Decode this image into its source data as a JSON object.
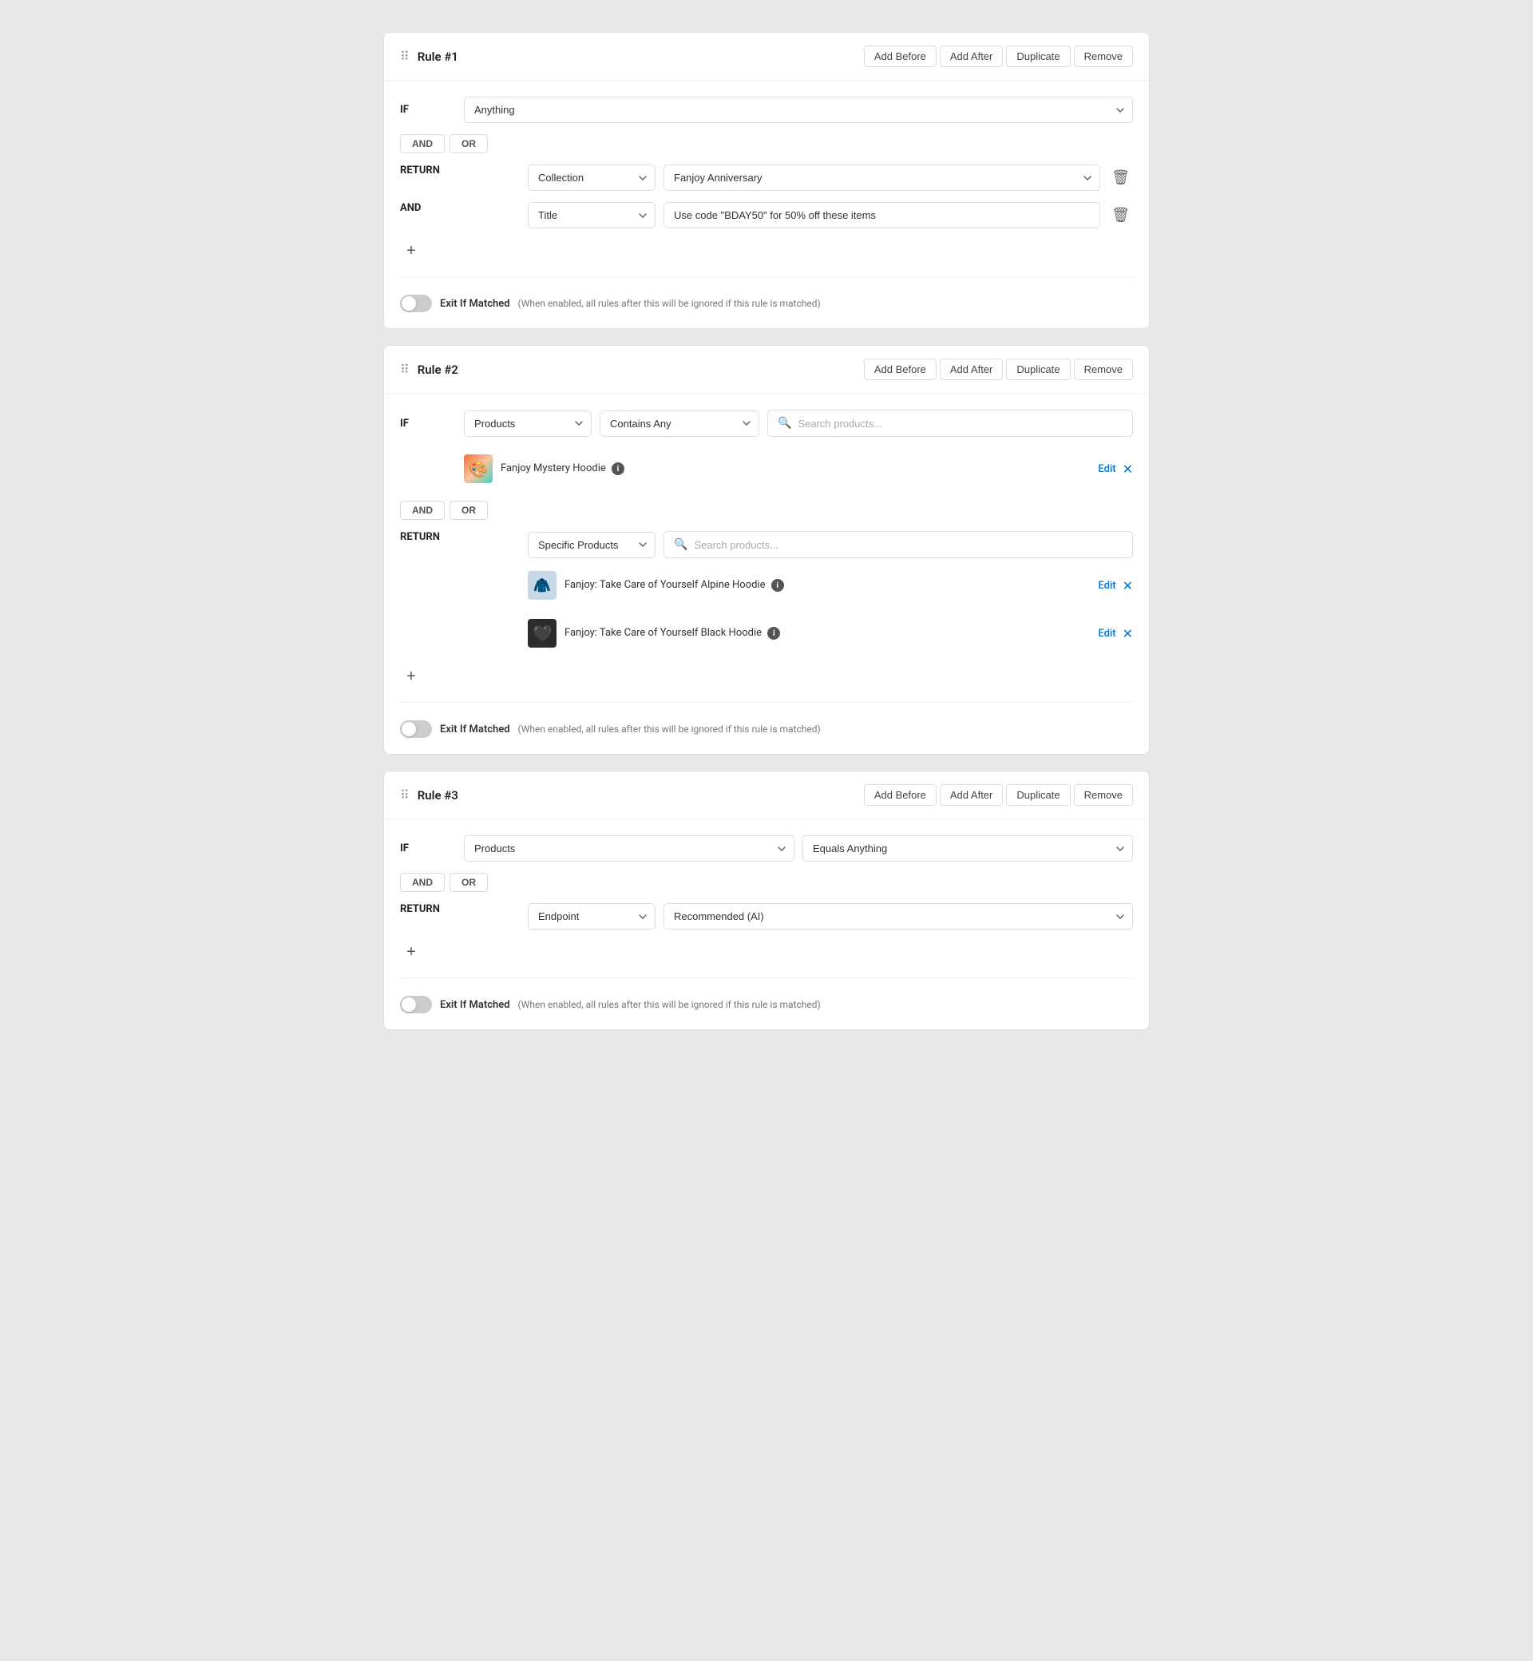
{
  "rules": [
    {
      "id": "rule1",
      "title": "Rule #1",
      "actions": [
        "Add Before",
        "Add After",
        "Duplicate",
        "Remove"
      ],
      "if_condition": {
        "field": "Anything"
      },
      "logic_buttons": [
        "AND",
        "OR"
      ],
      "return": {
        "type_label": "Collection",
        "value_label": "Fanjoy Anniversary",
        "has_delete": true
      },
      "and_condition": {
        "field_label": "Title",
        "value": "Use code \"BDAY50\" for 50% off these items",
        "has_delete": true
      },
      "exit_if_matched": {
        "enabled": false,
        "label": "Exit If Matched",
        "hint": "(When enabled, all rules after this will be ignored if this rule is matched)"
      }
    },
    {
      "id": "rule2",
      "title": "Rule #2",
      "actions": [
        "Add Before",
        "Add After",
        "Duplicate",
        "Remove"
      ],
      "if_condition": {
        "field": "Products",
        "operator": "Contains Any",
        "search_placeholder": "Search products..."
      },
      "if_products": [
        {
          "name": "Fanjoy Mystery Hoodie",
          "img_class": "img-hoodie-mystery",
          "img_emoji": "🎨"
        }
      ],
      "logic_buttons": [
        "AND",
        "OR"
      ],
      "return": {
        "type_label": "Specific Products",
        "search_placeholder": "Search products...",
        "has_delete": false
      },
      "return_products": [
        {
          "name": "Fanjoy: Take Care of Yourself Alpine Hoodie",
          "img_class": "img-hoodie-alpine",
          "img_emoji": "🧥"
        },
        {
          "name": "Fanjoy: Take Care of Yourself Black Hoodie",
          "img_class": "img-hoodie-black",
          "img_emoji": "🖤"
        }
      ],
      "exit_if_matched": {
        "enabled": false,
        "label": "Exit If Matched",
        "hint": "(When enabled, all rules after this will be ignored if this rule is matched)"
      }
    },
    {
      "id": "rule3",
      "title": "Rule #3",
      "actions": [
        "Add Before",
        "Add After",
        "Duplicate",
        "Remove"
      ],
      "if_condition": {
        "field": "Products",
        "operator": "Equals Anything"
      },
      "logic_buttons": [
        "AND",
        "OR"
      ],
      "return": {
        "type_label": "Endpoint",
        "value_label": "Recommended (AI)",
        "has_delete": false
      },
      "exit_if_matched": {
        "enabled": false,
        "label": "Exit If Matched",
        "hint": "(When enabled, all rules after this will be ignored if this rule is matched)"
      }
    }
  ],
  "labels": {
    "if": "IF",
    "and": "AND",
    "return": "RETURN",
    "add_condition": "+",
    "edit": "Edit",
    "info": "i"
  }
}
